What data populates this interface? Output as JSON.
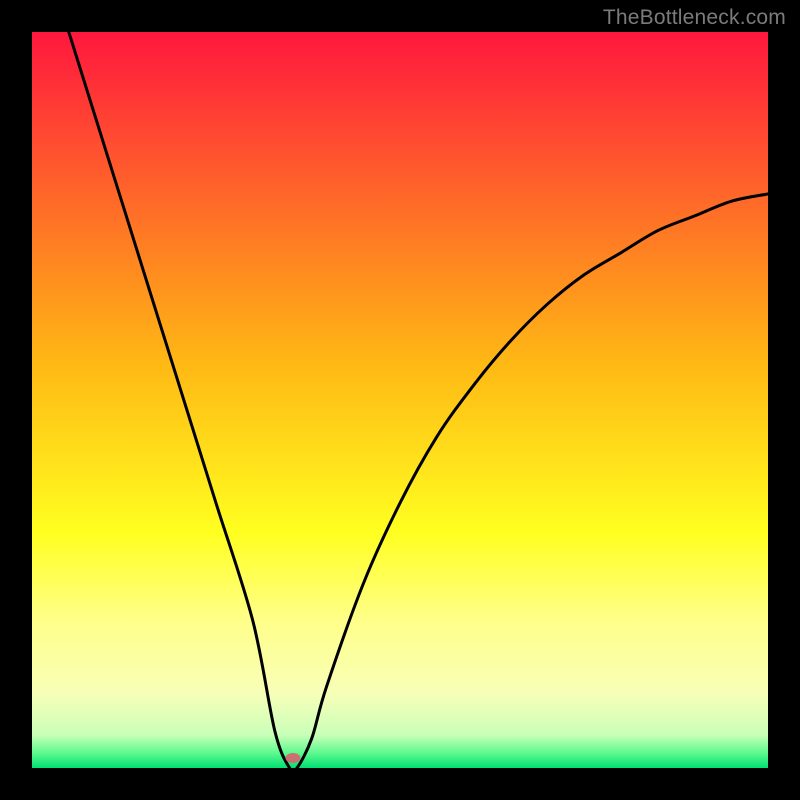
{
  "watermark": "TheBottleneck.com",
  "chart_data": {
    "type": "line",
    "title": "",
    "xlabel": "",
    "ylabel": "",
    "xlim": [
      0,
      100
    ],
    "ylim": [
      0,
      100
    ],
    "grid": false,
    "background_gradient": {
      "stops": [
        {
          "offset": 0.0,
          "color": "#ff173e"
        },
        {
          "offset": 0.45,
          "color": "#ffb814"
        },
        {
          "offset": 0.68,
          "color": "#ffff20"
        },
        {
          "offset": 0.8,
          "color": "#ffff8a"
        },
        {
          "offset": 0.9,
          "color": "#f7ffb8"
        },
        {
          "offset": 0.955,
          "color": "#c9ffb8"
        },
        {
          "offset": 0.98,
          "color": "#5cf98e"
        },
        {
          "offset": 1.0,
          "color": "#00e072"
        }
      ]
    },
    "series": [
      {
        "name": "bottleneck-curve",
        "color": "#000000",
        "x": [
          5,
          10,
          15,
          20,
          25,
          30,
          33,
          35,
          36,
          38,
          40,
          45,
          50,
          55,
          60,
          65,
          70,
          75,
          80,
          85,
          90,
          95,
          100
        ],
        "y": [
          100,
          84,
          68,
          52,
          36,
          20,
          5,
          0,
          0,
          4,
          11,
          25,
          36,
          45,
          52,
          58,
          63,
          67,
          70,
          73,
          75,
          77,
          78
        ]
      }
    ],
    "marker": {
      "name": "optimal-point",
      "x": 35.5,
      "y": 1.3,
      "color": "#c97070"
    }
  }
}
